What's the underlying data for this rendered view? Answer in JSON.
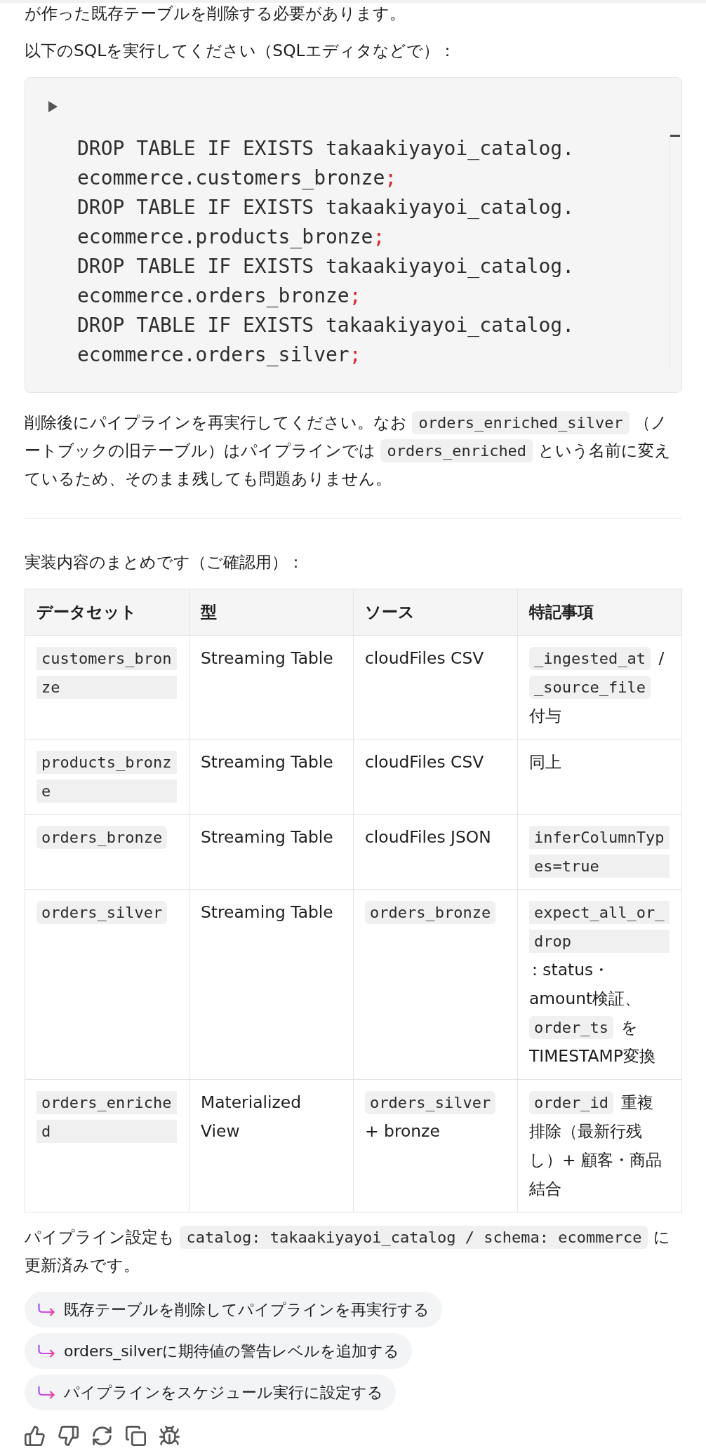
{
  "blocks": [
    {
      "kind": "paragraph",
      "segments": [
        {
          "kind": "text",
          "text": "が作った既存テーブルを削除する必要があります。"
        }
      ]
    },
    {
      "kind": "paragraph",
      "segments": [
        {
          "kind": "text",
          "text": "以下のSQLを実行してください（SQLエディタなどで）："
        }
      ]
    },
    {
      "kind": "code",
      "lines": [
        [
          {
            "kind": "plain",
            "text": "DROP TABLE IF EXISTS takaakiyayoi_catalog."
          }
        ],
        [
          {
            "kind": "plain",
            "text": "ecommerce.customers_bronze"
          },
          {
            "kind": "punctuation",
            "text": ";"
          }
        ],
        [
          {
            "kind": "plain",
            "text": "DROP TABLE IF EXISTS takaakiyayoi_catalog."
          }
        ],
        [
          {
            "kind": "plain",
            "text": "ecommerce.products_bronze"
          },
          {
            "kind": "punctuation",
            "text": ";"
          }
        ],
        [
          {
            "kind": "plain",
            "text": "DROP TABLE IF EXISTS takaakiyayoi_catalog."
          }
        ],
        [
          {
            "kind": "plain",
            "text": "ecommerce.orders_bronze"
          },
          {
            "kind": "punctuation",
            "text": ";"
          }
        ],
        [
          {
            "kind": "plain",
            "text": "DROP TABLE IF EXISTS takaakiyayoi_catalog."
          }
        ],
        [
          {
            "kind": "plain",
            "text": "ecommerce.orders_silver"
          },
          {
            "kind": "punctuation",
            "text": ";"
          }
        ]
      ]
    },
    {
      "kind": "paragraph",
      "segments": [
        {
          "kind": "text",
          "text": "削除後にパイプラインを再実行してください。なお "
        },
        {
          "kind": "code",
          "text": "orders_enriched_silver"
        },
        {
          "kind": "text",
          "text": " （ノートブックの旧テーブル）はパイプラインでは "
        },
        {
          "kind": "code",
          "text": "orders_enriched"
        },
        {
          "kind": "text",
          "text": " という名前に変えているため、そのまま残しても問題ありません。"
        }
      ]
    },
    {
      "kind": "divider"
    },
    {
      "kind": "paragraph",
      "segments": [
        {
          "kind": "text",
          "text": "実装内容のまとめです（ご確認用）："
        }
      ]
    },
    {
      "kind": "table",
      "columns": [
        "データセット",
        "型",
        "ソース",
        "特記事項"
      ],
      "rows": [
        [
          [
            {
              "kind": "code",
              "text": "customers_bronze"
            }
          ],
          [
            {
              "kind": "text",
              "text": "Streaming Table"
            }
          ],
          [
            {
              "kind": "text",
              "text": "cloudFiles CSV"
            }
          ],
          [
            {
              "kind": "code",
              "text": "_ingested_at"
            },
            {
              "kind": "text",
              "text": " / "
            },
            {
              "kind": "code",
              "text": "_source_file"
            },
            {
              "kind": "text",
              "text": " 付与"
            }
          ]
        ],
        [
          [
            {
              "kind": "code",
              "text": "products_bronze"
            }
          ],
          [
            {
              "kind": "text",
              "text": "Streaming Table"
            }
          ],
          [
            {
              "kind": "text",
              "text": "cloudFiles CSV"
            }
          ],
          [
            {
              "kind": "text",
              "text": "同上"
            }
          ]
        ],
        [
          [
            {
              "kind": "code",
              "text": "orders_bronze"
            }
          ],
          [
            {
              "kind": "text",
              "text": "Streaming Table"
            }
          ],
          [
            {
              "kind": "text",
              "text": "cloudFiles JSON"
            }
          ],
          [
            {
              "kind": "code",
              "text": "inferColumnTypes=true"
            }
          ]
        ],
        [
          [
            {
              "kind": "code",
              "text": "orders_silver"
            }
          ],
          [
            {
              "kind": "text",
              "text": "Streaming Table"
            }
          ],
          [
            {
              "kind": "code",
              "text": "orders_bronze"
            }
          ],
          [
            {
              "kind": "code",
              "text": "expect_all_or_drop"
            },
            {
              "kind": "text",
              "text": ": status・amount検証、"
            },
            {
              "kind": "code",
              "text": "order_ts"
            },
            {
              "kind": "text",
              "text": " をTIMESTAMP変換"
            }
          ]
        ],
        [
          [
            {
              "kind": "code",
              "text": "orders_enriched"
            }
          ],
          [
            {
              "kind": "text",
              "text": "Materialized View"
            }
          ],
          [
            {
              "kind": "code",
              "text": "orders_silver"
            },
            {
              "kind": "text",
              "text": " + bronze"
            }
          ],
          [
            {
              "kind": "code",
              "text": "order_id"
            },
            {
              "kind": "text",
              "text": " 重複排除（最新行残し）+ 顧客・商品結合"
            }
          ]
        ]
      ]
    },
    {
      "kind": "paragraph",
      "segments": [
        {
          "kind": "text",
          "text": "パイプライン設定も "
        },
        {
          "kind": "code",
          "text": "catalog: takaakiyayoi_catalog / schema: ecommerce"
        },
        {
          "kind": "text",
          "text": " に更新済みです。"
        }
      ]
    }
  ],
  "suggestions": [
    {
      "label": "既存テーブルを削除してパイプラインを再実行する"
    },
    {
      "label": "orders_silverに期待値の警告レベルを追加する"
    },
    {
      "label": "パイプラインをスケジュール実行に設定する"
    }
  ]
}
